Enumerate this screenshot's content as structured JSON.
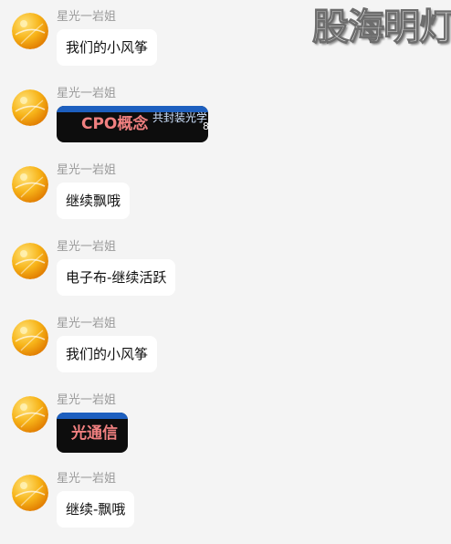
{
  "watermark": "股海明灯",
  "messages": [
    {
      "sender": "星光一岩姐",
      "text": "我们的小风筝"
    },
    {
      "sender": "星光一岩姐",
      "image_text": "CPO概念",
      "image_subtext": "共封装光学",
      "image_edge": "8"
    },
    {
      "sender": "星光一岩姐",
      "text": "继续飘哦"
    },
    {
      "sender": "星光一岩姐",
      "text": "电子布-继续活跃"
    },
    {
      "sender": "星光一岩姐",
      "text": "我们的小风筝"
    },
    {
      "sender": "星光一岩姐",
      "image_text": "光通信"
    },
    {
      "sender": "星光一岩姐",
      "text": "继续-飘哦"
    }
  ],
  "colors": {
    "background": "#f4f4f4",
    "bubble": "#ffffff",
    "sender_name": "#9a9a9a",
    "sticker_band": "#1d5fbf",
    "sticker_text": "#f08080",
    "avatar": "#f5a623"
  },
  "icons": {
    "avatar": "orange-sphere-avatar-icon"
  }
}
